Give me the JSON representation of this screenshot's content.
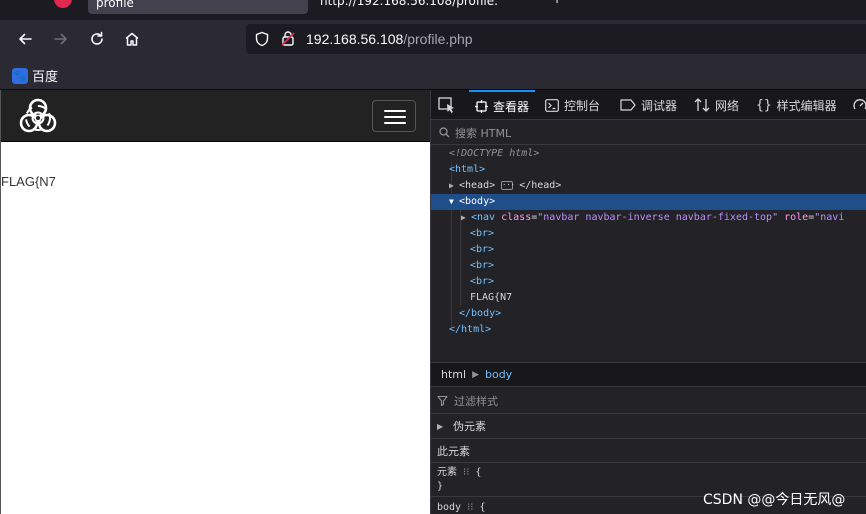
{
  "tabs": {
    "active_title": "profile",
    "inactive_title": "http://192.168.56.108/profile.",
    "inactive_end": "+"
  },
  "toolbar": {
    "url_host": "192.168.56.108",
    "url_path": "/profile.php",
    "icons": [
      "back-arrow-icon",
      "forward-arrow-icon",
      "reload-icon",
      "home-icon",
      "shield-icon",
      "lock-insecure-icon"
    ]
  },
  "bookmarks": {
    "items": [
      {
        "label": "百度",
        "icon": "baidu-paw-icon"
      }
    ]
  },
  "page": {
    "logo": "biohazard-logo",
    "flag_text": "FLAG{N7"
  },
  "devtools": {
    "tabs": [
      {
        "label": "查看器",
        "icon": "inspector-icon",
        "active": true
      },
      {
        "label": "控制台",
        "icon": "console-icon",
        "active": false
      },
      {
        "label": "调试器",
        "icon": "debugger-icon",
        "active": false
      },
      {
        "label": "网络",
        "icon": "network-icon",
        "active": false
      },
      {
        "label": "样式编辑器",
        "icon": "style-editor-icon",
        "active": false
      }
    ],
    "search_placeholder": "搜索 HTML",
    "tree": {
      "doctype": "<!DOCTYPE html>",
      "html_open": "<html>",
      "head_open": "<head>",
      "head_close": "</head>",
      "body_open": "<body>",
      "nav_tag": "<nav",
      "nav_class_attr": "class",
      "nav_class_val": "\"navbar navbar-inverse navbar-fixed-top\"",
      "nav_role_attr": "role",
      "nav_role_val": "\"navi",
      "br": "<br>",
      "flag_text": "FLAG{N7",
      "body_close": "</body>",
      "html_close": "</html>"
    },
    "breadcrumbs": [
      "html",
      "body"
    ],
    "filter_placeholder": "过滤样式",
    "pseudo_elements": "伪元素",
    "this_element": "此元素",
    "element_rule": "元素",
    "element_brace_open": "{",
    "element_brace_close": "}",
    "body_rule": "body",
    "body_brace_open": "{"
  },
  "watermark": "CSDN @@今日无风@"
}
